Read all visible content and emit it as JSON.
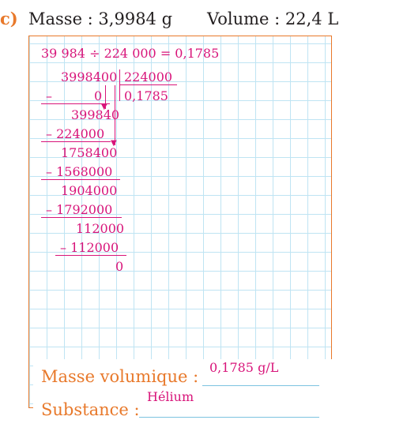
{
  "header": {
    "label": "c)",
    "mass": "Masse : 3,9984 g",
    "volume": "Volume : 22,4 L"
  },
  "calc": {
    "equation": "39 984 ÷ 224 000 = 0,1785",
    "dividend": "3998400",
    "divisor": "224000",
    "quotient": "0,1785",
    "minus": "–",
    "step1_sub": "0",
    "step1_rem": "399840",
    "step2_sub": "– 224000",
    "step2_rem": "1758400",
    "step3_sub": "– 1568000",
    "step3_rem": "1904000",
    "step4_sub": "– 1792000",
    "step4_rem": "112000",
    "step5_sub": "– 112000",
    "step5_rem": "0"
  },
  "answers": {
    "density_label": "Masse volumique :",
    "density_value": "0,1785 g/L",
    "substance_label": "Substance :",
    "substance_value": "Hélium"
  },
  "colors": {
    "accent": "#e8792b",
    "ink": "#d8157a",
    "grid": "#bfe4f3"
  }
}
